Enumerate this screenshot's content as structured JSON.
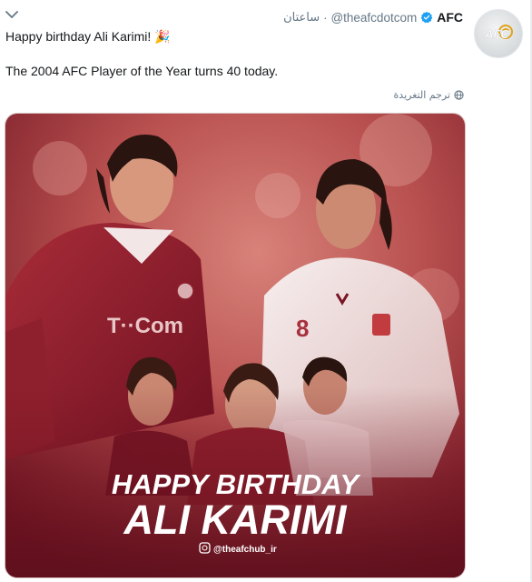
{
  "tweet": {
    "display_name": "AFC",
    "handle": "@theafcdotcom",
    "separator": "·",
    "time": "ساعتان",
    "text_line1": "Happy birthday Ali Karimi!",
    "text_emoji": "🎉",
    "text_line2": "The 2004 AFC Player of the Year turns 40 today.",
    "translate_label": "ترجم التغريدة"
  },
  "avatar": {
    "logo_text": "AFC"
  },
  "image": {
    "headline": "HAPPY BIRTHDAY",
    "name": "ALI KARIMI",
    "instagram_handle": "@theafchub_ir",
    "shirt_sponsor": "T··Com",
    "shirt_number": "8",
    "accent_color": "#8e1f2c",
    "bg_color_light": "#c9645d",
    "bg_color_dark": "#7a1524"
  },
  "colors": {
    "verified_blue": "#1da1f2",
    "meta_gray": "#657786",
    "text": "#14171a"
  }
}
